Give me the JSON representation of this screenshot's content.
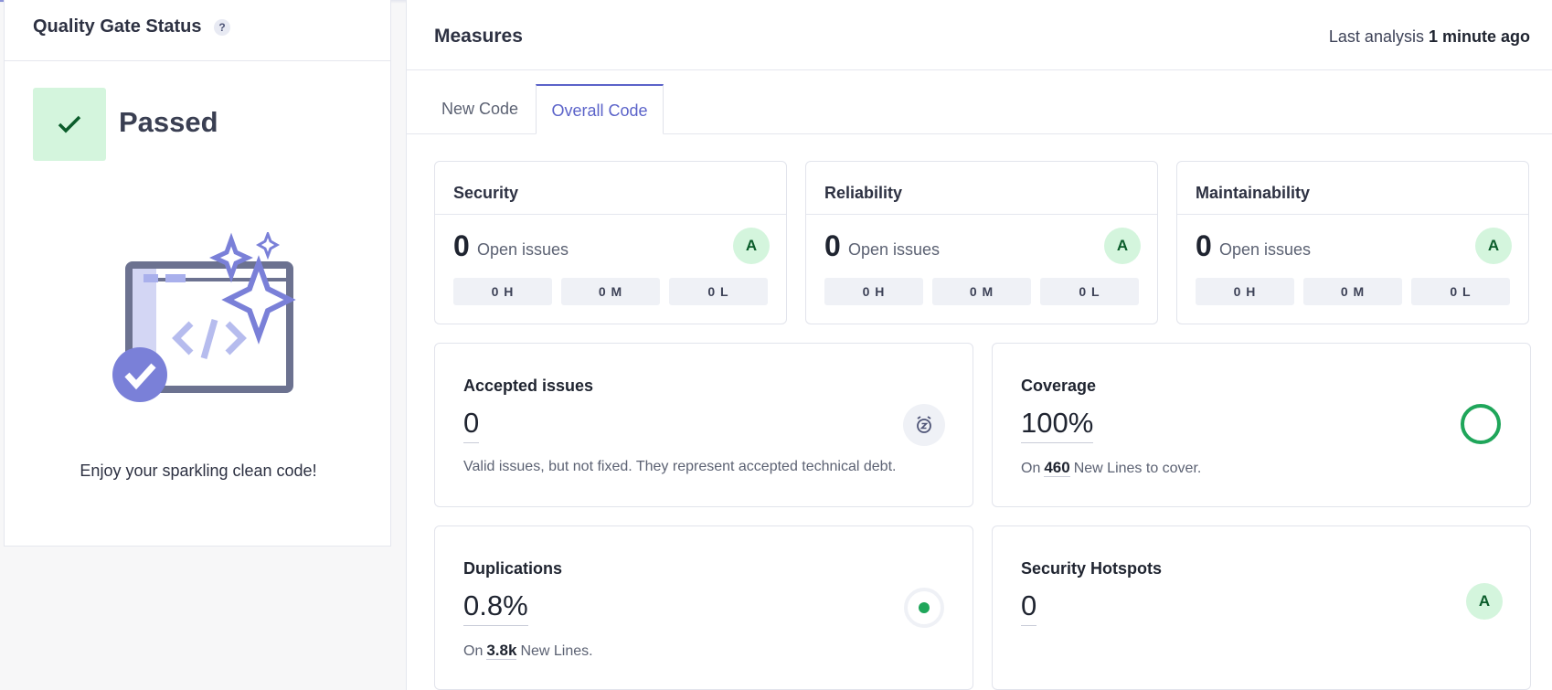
{
  "quality_gate": {
    "title": "Quality Gate Status",
    "help": "?",
    "status": "Passed",
    "message": "Enjoy your sparkling clean code!"
  },
  "measures": {
    "title": "Measures",
    "last_analysis_label": "Last analysis",
    "last_analysis_value": "1 minute ago",
    "tabs": [
      {
        "label": "New Code",
        "active": false
      },
      {
        "label": "Overall Code",
        "active": true
      }
    ]
  },
  "ratings": [
    {
      "title": "Security",
      "count": "0",
      "label": "Open issues",
      "grade": "A",
      "high": "0 H",
      "medium": "0 M",
      "low": "0 L"
    },
    {
      "title": "Reliability",
      "count": "0",
      "label": "Open issues",
      "grade": "A",
      "high": "0 H",
      "medium": "0 M",
      "low": "0 L"
    },
    {
      "title": "Maintainability",
      "count": "0",
      "label": "Open issues",
      "grade": "A",
      "high": "0 H",
      "medium": "0 M",
      "low": "0 L"
    }
  ],
  "accepted_issues": {
    "title": "Accepted issues",
    "value": "0",
    "description": "Valid issues, but not fixed. They represent accepted technical debt.",
    "icon": "snooze-icon"
  },
  "coverage": {
    "title": "Coverage",
    "value": "100%",
    "desc_prefix": "On",
    "lines": "460",
    "desc_suffix": "New Lines to cover.",
    "percent": 100,
    "color": "#1fa65a"
  },
  "duplications": {
    "title": "Duplications",
    "value": "0.8%",
    "desc_prefix": "On",
    "lines": "3.8k",
    "desc_suffix": "New Lines.",
    "color": "#1fa65a"
  },
  "security_hotspots": {
    "title": "Security Hotspots",
    "value": "0",
    "grade": "A"
  },
  "colors": {
    "accent": "#5b63c9",
    "passed_bg": "#d4f5dd",
    "passed_check": "#0a5c2a"
  }
}
